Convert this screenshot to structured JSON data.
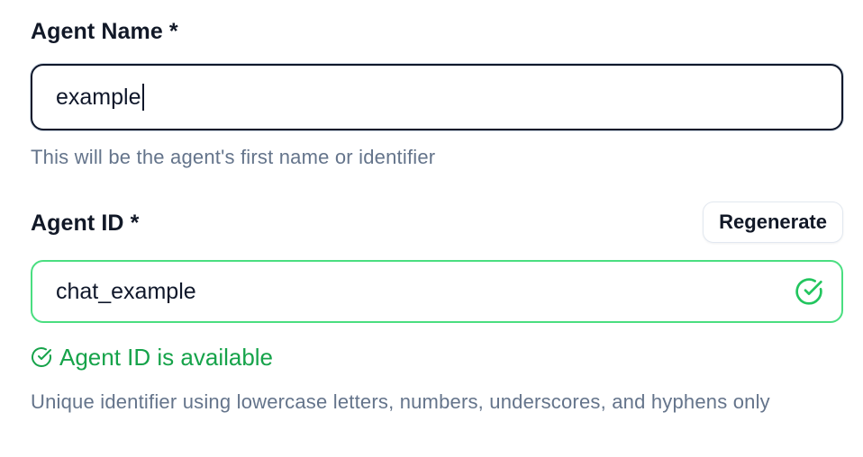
{
  "agent_name": {
    "label": "Agent Name *",
    "value": "example",
    "help": "This will be the agent's first name or identifier"
  },
  "agent_id": {
    "label": "Agent ID *",
    "regenerate_label": "Regenerate",
    "value": "chat_example",
    "status": "Agent ID is available",
    "status_icon": "check-circle-icon",
    "help": "Unique identifier using lowercase letters, numbers, underscores, and hyphens only"
  },
  "colors": {
    "success": "#16a34a",
    "success_border": "#4ade80",
    "focus_border": "#0f172a",
    "help_text": "#64748b"
  }
}
